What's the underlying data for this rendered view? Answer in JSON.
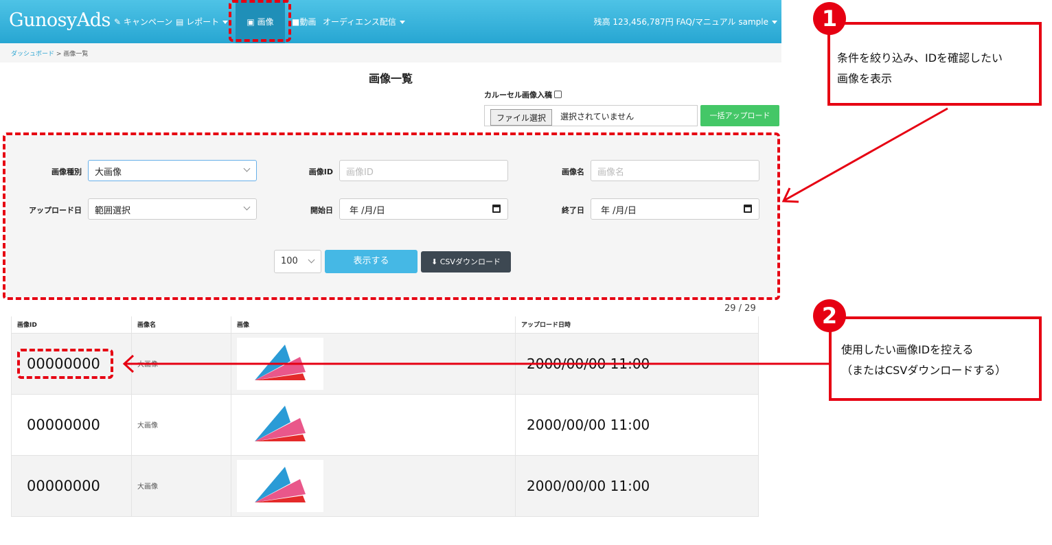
{
  "nav": {
    "brand": "GunosyAds",
    "campaign": "キャンペーン",
    "report": "レポート",
    "image": "画像",
    "video": "動画",
    "audience": "オーディエンス配信",
    "balance": "残高 123,456,787円",
    "faq": "FAQ/マニュアル",
    "user": "sample"
  },
  "breadcrumb": {
    "dashboard": "ダッシュボード",
    "sep": ">",
    "current": "画像一覧"
  },
  "page_title": "画像一覧",
  "upload": {
    "carousel_label": "カルーセル画像入稿",
    "file_button": "ファイル選択",
    "file_status": "選択されていません",
    "bulk_upload": "一括アップロード"
  },
  "filter": {
    "type_label": "画像種別",
    "type_value": "大画像",
    "id_label": "画像ID",
    "id_placeholder": "画像ID",
    "name_label": "画像名",
    "name_placeholder": "画像名",
    "upload_date_label": "アップロード日",
    "upload_date_value": "範囲選択",
    "start_label": "開始日",
    "start_value": "年 /月/日",
    "end_label": "終了日",
    "end_value": "年 /月/日",
    "per_page": "100",
    "show_button": "表示する",
    "csv_button": "CSVダウンロード"
  },
  "counter": "29 / 29",
  "table": {
    "headers": [
      "画像ID",
      "画像名",
      "画像",
      "アップロード日時"
    ],
    "rows": [
      {
        "id": "00000000",
        "name": "大画像",
        "date": "2000/00/00 11:00"
      },
      {
        "id": "00000000",
        "name": "大画像",
        "date": "2000/00/00 11:00"
      },
      {
        "id": "00000000",
        "name": "大画像",
        "date": "2000/00/00 11:00"
      }
    ]
  },
  "callouts": [
    {
      "number": "1",
      "text_line1": "条件を絞り込み、IDを確認したい",
      "text_line2": "画像を表示"
    },
    {
      "number": "2",
      "text_line1": "使用したい画像IDを控える",
      "text_line2": "（またはCSVダウンロードする）"
    }
  ],
  "colors": {
    "nav": "#27a6d2",
    "accent": "#45b8e5",
    "annotation": "#e60012",
    "success": "#44c767"
  }
}
